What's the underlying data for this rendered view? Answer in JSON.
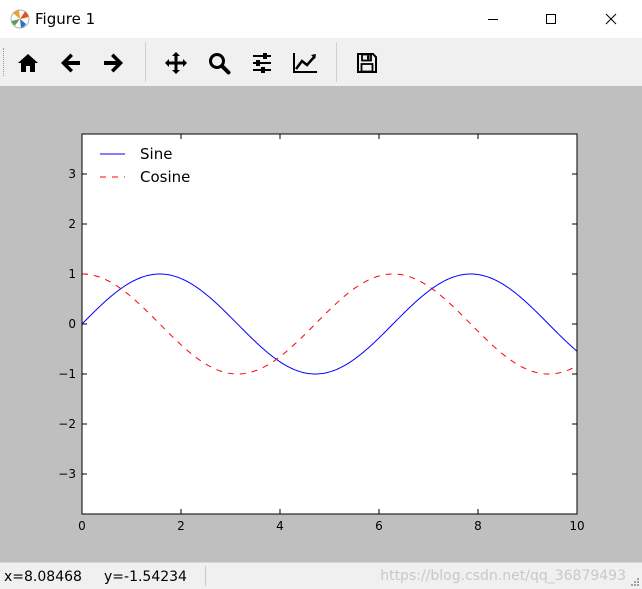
{
  "window": {
    "title": "Figure 1"
  },
  "toolbar": {
    "buttons": [
      {
        "icon": "home-icon"
      },
      {
        "icon": "back-arrow-icon"
      },
      {
        "icon": "forward-arrow-icon"
      },
      {
        "icon": "pan-icon"
      },
      {
        "icon": "zoom-icon"
      },
      {
        "icon": "subplots-config-icon"
      },
      {
        "icon": "edit-axis-icon"
      },
      {
        "icon": "save-icon"
      }
    ]
  },
  "chart_data": {
    "type": "line",
    "xlim": [
      0,
      10
    ],
    "ylim": [
      -3.8,
      3.8
    ],
    "xticks": [
      "0",
      "2",
      "4",
      "6",
      "8",
      "10"
    ],
    "yticks": [
      "−3",
      "−2",
      "−1",
      "0",
      "1",
      "2",
      "3"
    ],
    "grid": false,
    "legend_position": "top-left",
    "series": [
      {
        "name": "Sine",
        "color": "#0000ff",
        "style": "solid",
        "function": "sin"
      },
      {
        "name": "Cosine",
        "color": "#ff0000",
        "style": "dashed",
        "function": "cos"
      }
    ]
  },
  "status": {
    "x_readout": "x=8.08468",
    "y_readout": "y=-1.54234",
    "watermark": "https://blog.csdn.net/qq_36879493"
  }
}
